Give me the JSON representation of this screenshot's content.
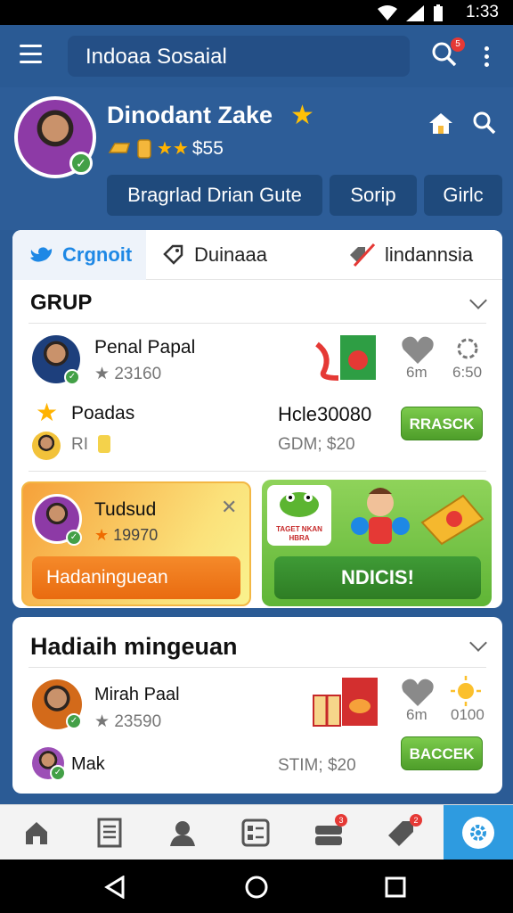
{
  "status_bar": {
    "time": "1:33"
  },
  "app_bar": {
    "search_text": "Indoaa Sosaial",
    "notification_count": "5"
  },
  "profile": {
    "name": "Dinodant Zake",
    "balance": "$55",
    "chips": [
      "Bragrlad Drian Gute",
      "Sorip",
      "Girlc"
    ]
  },
  "tabs": [
    "Crgnoit",
    "Duinaaa",
    "lindannsia"
  ],
  "group_section": {
    "title": "GRUP",
    "rows": [
      {
        "name": "Penal Papal",
        "score": "23160",
        "stat1": "6m",
        "stat2": "6:50"
      },
      {
        "name": "Poadas",
        "sub": "RI",
        "amount": "Hcle30080",
        "price": "GDM; $20",
        "button": "RRASCK"
      }
    ]
  },
  "promo_left": {
    "name": "Tudsud",
    "score": "19970",
    "button": "Hadaninguean"
  },
  "promo_right": {
    "sticker_text": "TAGET NKAN HBRA",
    "button": "NDICIS!"
  },
  "weekly_section": {
    "title": "Hadiaih mingeuan",
    "rows": [
      {
        "name": "Mirah Paal",
        "score": "23590",
        "stat1": "6m",
        "stat2": "0100"
      },
      {
        "name": "Mak",
        "price": "STIM; $20",
        "button": "BACCEK"
      }
    ]
  },
  "bottom_nav": {
    "badge_counts": [
      "3",
      "2"
    ]
  },
  "colors": {
    "brand_blue": "#2a5a94",
    "accent_green": "#4e9e2a",
    "active_tab": "#2e9be0",
    "star": "#ffc107"
  }
}
